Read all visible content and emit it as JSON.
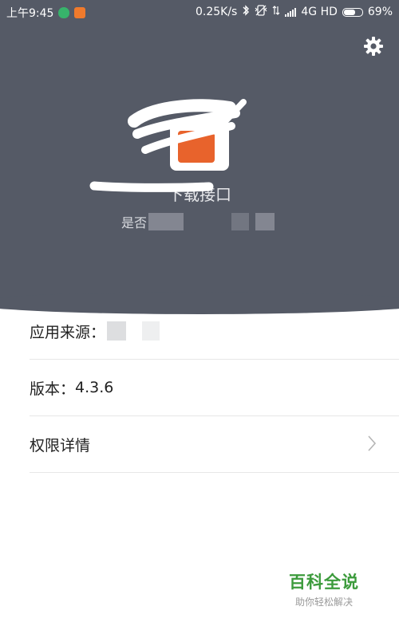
{
  "status_bar": {
    "time": "上午9:45",
    "network_speed": "0.25K/s",
    "network_type": "4G HD",
    "battery_percent": "69%",
    "battery_level": 0.69,
    "icons": [
      "shield-notification-icon",
      "app-notification-icon",
      "bluetooth-icon",
      "vibrate-icon",
      "data-icon",
      "signal-icon",
      "battery-icon"
    ]
  },
  "header": {
    "settings_icon": "gear-icon",
    "app_name": "下载接口",
    "app_subtitle": "是否",
    "colors": {
      "background": "#555a66",
      "app_icon_accent": "#e8632c"
    }
  },
  "list": {
    "source": {
      "label": "应用来源："
    },
    "version": {
      "label": "版本：",
      "value": "4.3.6"
    },
    "permissions": {
      "label": "权限详情",
      "chevron_icon": "chevron-right-icon"
    }
  },
  "watermark": {
    "title": "百科全说",
    "subtitle": "助你轻松解决",
    "color": "#3c9b3c"
  }
}
